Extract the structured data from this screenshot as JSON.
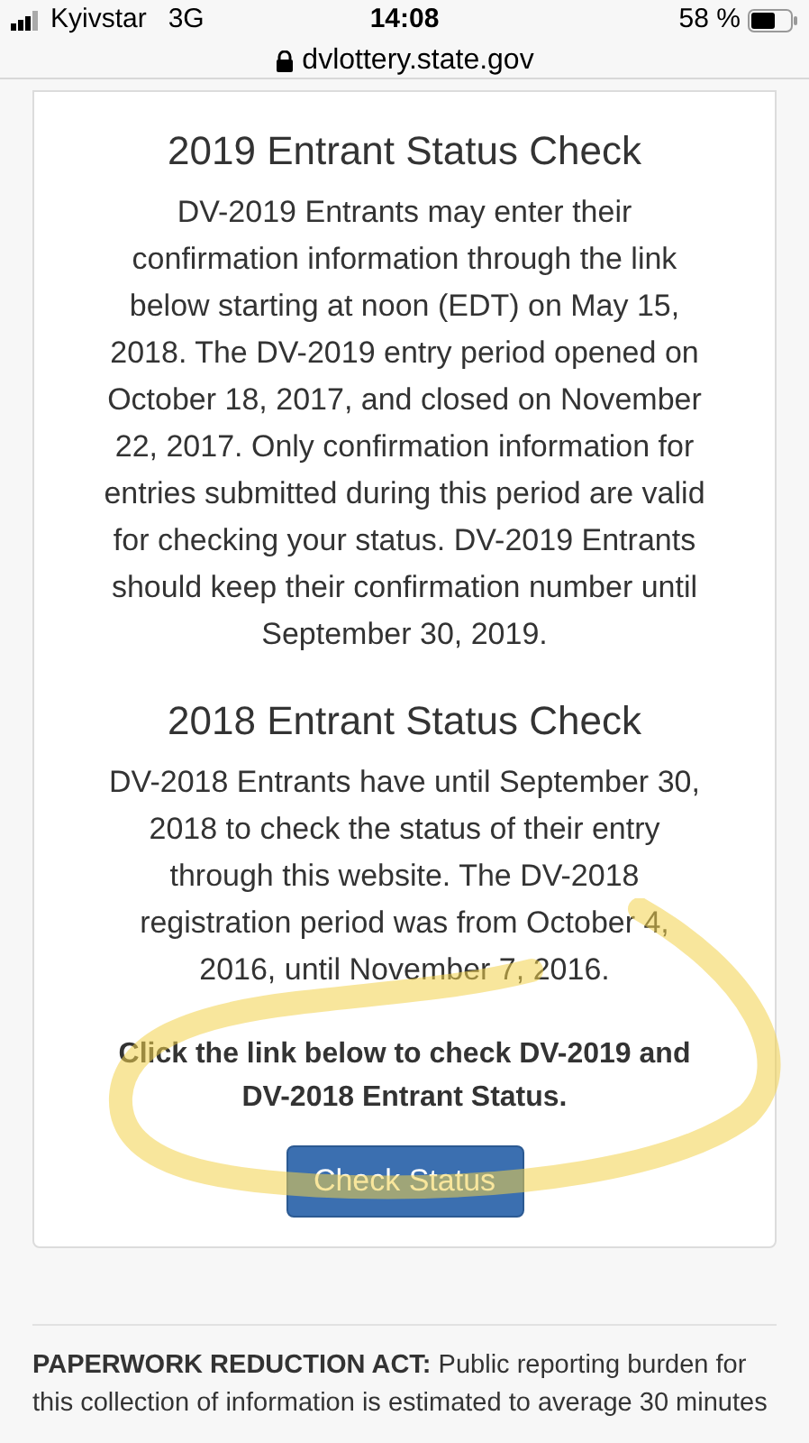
{
  "status_bar": {
    "carrier": "Kyivstar",
    "network": "3G",
    "time": "14:08",
    "battery": "58 %"
  },
  "address_bar": {
    "url": "dvlottery.state.gov"
  },
  "sections": [
    {
      "title": "2019 Entrant Status Check",
      "text": "DV-2019 Entrants may enter their confirmation information through the link below starting at noon (EDT) on May 15, 2018. The DV-2019 entry period opened on October 18, 2017, and closed on November 22, 2017. Only confirmation information for entries submitted during this period are valid for checking your status. DV-2019 Entrants should keep their confirmation number until September 30, 2019."
    },
    {
      "title": "2018 Entrant Status Check",
      "text": "DV-2018 Entrants have until September 30, 2018 to check the status of their entry through this website. The DV-2018 registration period was from October 4, 2016, until November 7, 2016."
    }
  ],
  "call_to_action": "Click the link below to check DV-2019 and DV-2018 Entrant Status.",
  "button": "Check Status",
  "footer_note": "**PAPERWORK REDUCTION ACT:** Public reporting burden for this collection of information is estimated to average 30 minutes"
}
